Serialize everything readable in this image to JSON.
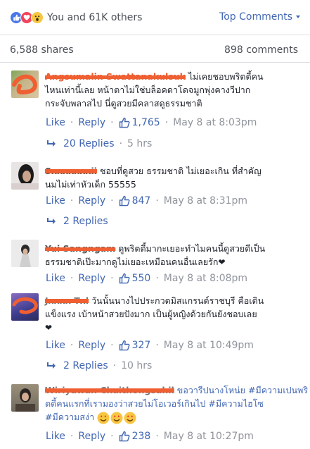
{
  "header": {
    "reactions": [
      "like-icon",
      "love-icon",
      "wow-icon"
    ],
    "reaction_summary": "You and 61K others",
    "sort_label": "Top Comments",
    "shares": "6,588 shares",
    "comments": "898 comments"
  },
  "comments": [
    {
      "name": "Angsumalin Swattanakulsuk",
      "line1": "ไม่เคยชอบพริตตี้คน",
      "line2": "ไหนเท่านี้เลย หน้าตาไม่ใช่บล็อคดาโดจมูกพุ่งคางวีปาก",
      "line3": "กระจับพลาสไป นี่ดูสวยมีคลาสดูธรรมชาติ",
      "like": "Like",
      "reply": "Reply",
      "likes": "1,765",
      "time": "May 8 at 8:03pm",
      "replies": "20 Replies",
      "replies_time": "5 hrs"
    },
    {
      "name": "Sxxxxxxxii",
      "line1": "ชอบที่ดูสวย ธรรมชาติ ไม่เยอะเกิน ที่สำคัญ",
      "line2": "นมไม่เท่าหัวเด็ก 55555",
      "like": "Like",
      "reply": "Reply",
      "likes": "847",
      "time": "May 8 at 8:31pm",
      "replies": "2 Replies"
    },
    {
      "name": "Yui Sangngam",
      "line1": "ดูพริตตี้มากะเยอะทำไมคนนี้ดูสวยดีเป็น",
      "line2": "ธรรมชาติเป๊ะมากดูไม่เยอะเหมือนคนอื่นเลยรัก",
      "like": "Like",
      "reply": "Reply",
      "likes": "550",
      "time": "May 8 at 8:08pm"
    },
    {
      "name": "Jxxxx Txl",
      "line1": "วันนั้นนางไปประกวดมิสแกรนด์ราชบุรี คือเดิน",
      "line2": "แข็งแรง เบ้าหน้าสวยปังมาก เป็นผู้หญิงด้วยกันยังชอบเลย",
      "like": "Like",
      "reply": "Reply",
      "likes": "327",
      "time": "May 8 at 10:49pm",
      "replies": "2 Replies",
      "replies_time": "10 hrs"
    },
    {
      "name": "Wiriyawan Chaithongsahil",
      "line1": "ขอวารีปนางโหน่ย #มีความเปนพริ",
      "line2": "ตตี้คนแรกที่เรามองว่าสวยไม่โอเวอร์เกินไป #มีความไฮโซ",
      "line3": "#มีความสง่า",
      "like": "Like",
      "reply": "Reply",
      "likes": "238",
      "time": "May 8 at 10:27pm"
    }
  ],
  "colors": {
    "link": "#4267b2",
    "muted": "#90949c",
    "text": "#1d2129",
    "name_scribble": "#e85a2a"
  }
}
